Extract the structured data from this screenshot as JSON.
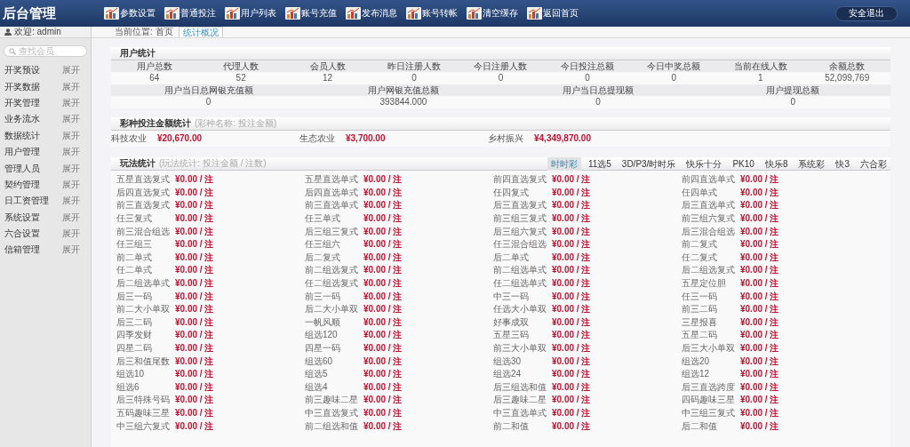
{
  "header": {
    "title": "后台管理",
    "nav": [
      {
        "label": "参数设置"
      },
      {
        "label": "普通投注"
      },
      {
        "label": "用户列表"
      },
      {
        "label": "账号充值"
      },
      {
        "label": "发布消息"
      },
      {
        "label": "账号转帐"
      },
      {
        "label": "清空缓存"
      },
      {
        "label": "返回首页"
      }
    ],
    "logout": "安全退出"
  },
  "sidebar": {
    "welcome": "欢迎: admin",
    "search": {
      "placeholder": "查找会员"
    },
    "items": [
      {
        "label": "开奖预设",
        "toggle": "展开"
      },
      {
        "label": "开奖数据",
        "toggle": "展开"
      },
      {
        "label": "开奖管理",
        "toggle": "展开"
      },
      {
        "label": "业务流水",
        "toggle": "展开"
      },
      {
        "label": "数据统计",
        "toggle": "展开"
      },
      {
        "label": "用户管理",
        "toggle": "展开"
      },
      {
        "label": "管理人员",
        "toggle": "展开"
      },
      {
        "label": "契约管理",
        "toggle": "展开"
      },
      {
        "label": "日工资管理",
        "toggle": "展开"
      },
      {
        "label": "系统设置",
        "toggle": "展开"
      },
      {
        "label": "六合设置",
        "toggle": "展开"
      },
      {
        "label": "信箱管理",
        "toggle": "展开"
      }
    ]
  },
  "breadcrumb": {
    "location": "当前位置: 首页",
    "tabs": [
      {
        "label": "统计概况",
        "selected": true
      }
    ]
  },
  "user_stats": {
    "title": "用户统计",
    "tables": [
      {
        "headers": [
          "用户总数",
          "代理人数",
          "会员人数",
          "昨日注册人数",
          "今日注册人数",
          "今日投注总额",
          "今日中奖总额",
          "当前在线人数",
          "余额总数"
        ],
        "values": [
          "64",
          "52",
          "12",
          "0",
          "0",
          "0",
          "0",
          "1",
          "52,099,769"
        ]
      },
      {
        "headers": [
          "用户当日总网银充值额",
          "用户网银充值总额",
          "用户当日总提现额",
          "用户提现总额"
        ],
        "values": [
          "0",
          "393844.000",
          "0",
          "0"
        ]
      }
    ]
  },
  "lottery_stats": {
    "title": "彩种投注金额统计",
    "subtitle": "(彩种名称: 投注金额)",
    "items": [
      {
        "name": "科技农业",
        "amount": "¥20,670.00"
      },
      {
        "name": "生态农业",
        "amount": "¥3,700.00"
      },
      {
        "name": "乡村振兴",
        "amount": "¥4,349,870.00"
      }
    ]
  },
  "play_stats": {
    "title": "玩法统计",
    "subtitle": "(玩法统计: 投注金额 / 注数)",
    "tabs": [
      {
        "label": "时时彩",
        "selected": true
      },
      {
        "label": "11选5",
        "selected": false
      },
      {
        "label": "3D/P3/时时乐",
        "selected": false
      },
      {
        "label": "快乐十分",
        "selected": false
      },
      {
        "label": "PK10",
        "selected": false
      },
      {
        "label": "快乐8",
        "selected": false
      },
      {
        "label": "系统彩",
        "selected": false
      },
      {
        "label": "快3",
        "selected": false
      },
      {
        "label": "六合彩",
        "selected": false
      }
    ],
    "items": [
      {
        "name": "五星直选复式",
        "value": "¥0.00 / 注"
      },
      {
        "name": "五星直选单式",
        "value": "¥0.00 / 注"
      },
      {
        "name": "前四直选复式",
        "value": "¥0.00 / 注"
      },
      {
        "name": "前四直选单式",
        "value": "¥0.00 / 注"
      },
      {
        "name": "后四直选复式",
        "value": "¥0.00 / 注"
      },
      {
        "name": "后四直选单式",
        "value": "¥0.00 / 注"
      },
      {
        "name": "任四复式",
        "value": "¥0.00 / 注"
      },
      {
        "name": "任四单式",
        "value": "¥0.00 / 注"
      },
      {
        "name": "前三直选复式",
        "value": "¥0.00 / 注"
      },
      {
        "name": "前三直选单式",
        "value": "¥0.00 / 注"
      },
      {
        "name": "后三直选复式",
        "value": "¥0.00 / 注"
      },
      {
        "name": "后三直选单式",
        "value": "¥0.00 / 注"
      },
      {
        "name": "任三复式",
        "value": "¥0.00 / 注"
      },
      {
        "name": "任三单式",
        "value": "¥0.00 / 注"
      },
      {
        "name": "前三组三复式",
        "value": "¥0.00 / 注"
      },
      {
        "name": "前三组六复式",
        "value": "¥0.00 / 注"
      },
      {
        "name": "前三混合组选",
        "value": "¥0.00 / 注"
      },
      {
        "name": "后三组三复式",
        "value": "¥0.00 / 注"
      },
      {
        "name": "后三组六复式",
        "value": "¥0.00 / 注"
      },
      {
        "name": "后三混合组选",
        "value": "¥0.00 / 注"
      },
      {
        "name": "任三组三",
        "value": "¥0.00 / 注"
      },
      {
        "name": "任三组六",
        "value": "¥0.00 / 注"
      },
      {
        "name": "任三混合组选",
        "value": "¥0.00 / 注"
      },
      {
        "name": "前二复式",
        "value": "¥0.00 / 注"
      },
      {
        "name": "前二单式",
        "value": "¥0.00 / 注"
      },
      {
        "name": "后二复式",
        "value": "¥0.00 / 注"
      },
      {
        "name": "后二单式",
        "value": "¥0.00 / 注"
      },
      {
        "name": "任二复式",
        "value": "¥0.00 / 注"
      },
      {
        "name": "任二单式",
        "value": "¥0.00 / 注"
      },
      {
        "name": "前二组选复式",
        "value": "¥0.00 / 注"
      },
      {
        "name": "前二组选单式",
        "value": "¥0.00 / 注"
      },
      {
        "name": "后二组选复式",
        "value": "¥0.00 / 注"
      },
      {
        "name": "后二组选单式",
        "value": "¥0.00 / 注"
      },
      {
        "name": "任二组选复式",
        "value": "¥0.00 / 注"
      },
      {
        "name": "任二组选单式",
        "value": "¥0.00 / 注"
      },
      {
        "name": "五星定位胆",
        "value": "¥0.00 / 注"
      },
      {
        "name": "后三一码",
        "value": "¥0.00 / 注"
      },
      {
        "name": "前三一码",
        "value": "¥0.00 / 注"
      },
      {
        "name": "中三一码",
        "value": "¥0.00 / 注"
      },
      {
        "name": "任三一码",
        "value": "¥0.00 / 注"
      },
      {
        "name": "前二大小单双",
        "value": "¥0.00 / 注"
      },
      {
        "name": "后二大小单双",
        "value": "¥0.00 / 注"
      },
      {
        "name": "任选大小单双",
        "value": "¥0.00 / 注"
      },
      {
        "name": "前三二码",
        "value": "¥0.00 / 注"
      },
      {
        "name": "后三二码",
        "value": "¥0.00 / 注"
      },
      {
        "name": "一帆风顺",
        "value": "¥0.00 / 注"
      },
      {
        "name": "好事成双",
        "value": "¥0.00 / 注"
      },
      {
        "name": "三星报喜",
        "value": "¥0.00 / 注"
      },
      {
        "name": "四季发财",
        "value": "¥0.00 / 注"
      },
      {
        "name": "组选120",
        "value": "¥0.00 / 注"
      },
      {
        "name": "五星三码",
        "value": "¥0.00 / 注"
      },
      {
        "name": "五星二码",
        "value": "¥0.00 / 注"
      },
      {
        "name": "四星二码",
        "value": "¥0.00 / 注"
      },
      {
        "name": "四星一码",
        "value": "¥0.00 / 注"
      },
      {
        "name": "前三大小单双",
        "value": "¥0.00 / 注"
      },
      {
        "name": "后三大小单双",
        "value": "¥0.00 / 注"
      },
      {
        "name": "后三和值尾数",
        "value": "¥0.00 / 注"
      },
      {
        "name": "组选60",
        "value": "¥0.00 / 注"
      },
      {
        "name": "组选30",
        "value": "¥0.00 / 注"
      },
      {
        "name": "组选20",
        "value": "¥0.00 / 注"
      },
      {
        "name": "组选10",
        "value": "¥0.00 / 注"
      },
      {
        "name": "组选5",
        "value": "¥0.00 / 注"
      },
      {
        "name": "组选24",
        "value": "¥0.00 / 注"
      },
      {
        "name": "组选12",
        "value": "¥0.00 / 注"
      },
      {
        "name": "组选6",
        "value": "¥0.00 / 注"
      },
      {
        "name": "组选4",
        "value": "¥0.00 / 注"
      },
      {
        "name": "后三组选和值",
        "value": "¥0.00 / 注"
      },
      {
        "name": "后三直选跨度",
        "value": "¥0.00 / 注"
      },
      {
        "name": "后三特殊号码",
        "value": "¥0.00 / 注"
      },
      {
        "name": "前三趣味二星",
        "value": "¥0.00 / 注"
      },
      {
        "name": "后三趣味二星",
        "value": "¥0.00 / 注"
      },
      {
        "name": "四码趣味三星",
        "value": "¥0.00 / 注"
      },
      {
        "name": "五码趣味三星",
        "value": "¥0.00 / 注"
      },
      {
        "name": "中三直选复式",
        "value": "¥0.00 / 注"
      },
      {
        "name": "中三直选单式",
        "value": "¥0.00 / 注"
      },
      {
        "name": "中三组三复式",
        "value": "¥0.00 / 注"
      },
      {
        "name": "中三组六复式",
        "value": "¥0.00 / 注"
      },
      {
        "name": "前二组选和值",
        "value": "¥0.00 / 注"
      },
      {
        "name": "前二和值",
        "value": "¥0.00 / 注"
      },
      {
        "name": "后二和值",
        "value": "¥0.00 / 注"
      }
    ]
  }
}
